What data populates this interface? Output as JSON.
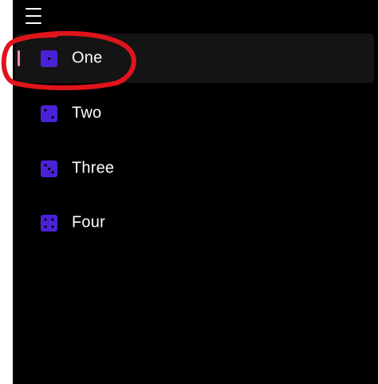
{
  "colors": {
    "pane_background": "#000000",
    "selected_background": "#141414",
    "accent_indicator": "#f28ab3",
    "dice_color": "#4a22d6",
    "annotation_color": "#e0141b"
  },
  "menu": {
    "icon": "hamburger-icon"
  },
  "nav": {
    "items": [
      {
        "label": "One",
        "icon": "dice-one-icon",
        "selected": true
      },
      {
        "label": "Two",
        "icon": "dice-two-icon",
        "selected": false
      },
      {
        "label": "Three",
        "icon": "dice-three-icon",
        "selected": false
      },
      {
        "label": "Four",
        "icon": "dice-four-icon",
        "selected": false
      }
    ]
  }
}
